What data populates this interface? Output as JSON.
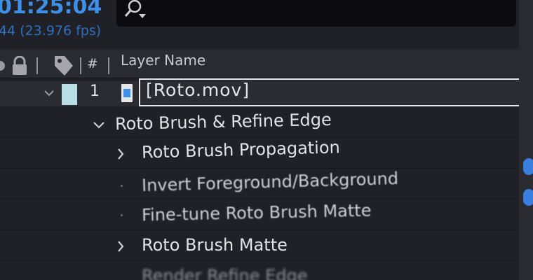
{
  "composition": {
    "timecode": "01:25:04",
    "fps": "44 (23.976 fps)"
  },
  "search": {
    "placeholder": ""
  },
  "header": {
    "number_col": "#",
    "layer_name_col": "Layer Name"
  },
  "layer": {
    "number": "1",
    "name": "[Roto.mov]",
    "label_color": "#b9dfe6"
  },
  "effects": {
    "group_label": "Roto Brush & Refine Edge",
    "items": [
      {
        "label": "Roto Brush Propagation",
        "expandable": true
      },
      {
        "label": "Invert Foreground/Background",
        "expandable": false
      },
      {
        "label": "Fine-tune Roto Brush Matte",
        "expandable": false
      },
      {
        "label": "Roto Brush Matte",
        "expandable": true
      },
      {
        "label": "Render Refine Edge",
        "expandable": false
      }
    ]
  },
  "colors": {
    "accent": "#3e8fe8",
    "header_highlight": "#d9d7df"
  }
}
